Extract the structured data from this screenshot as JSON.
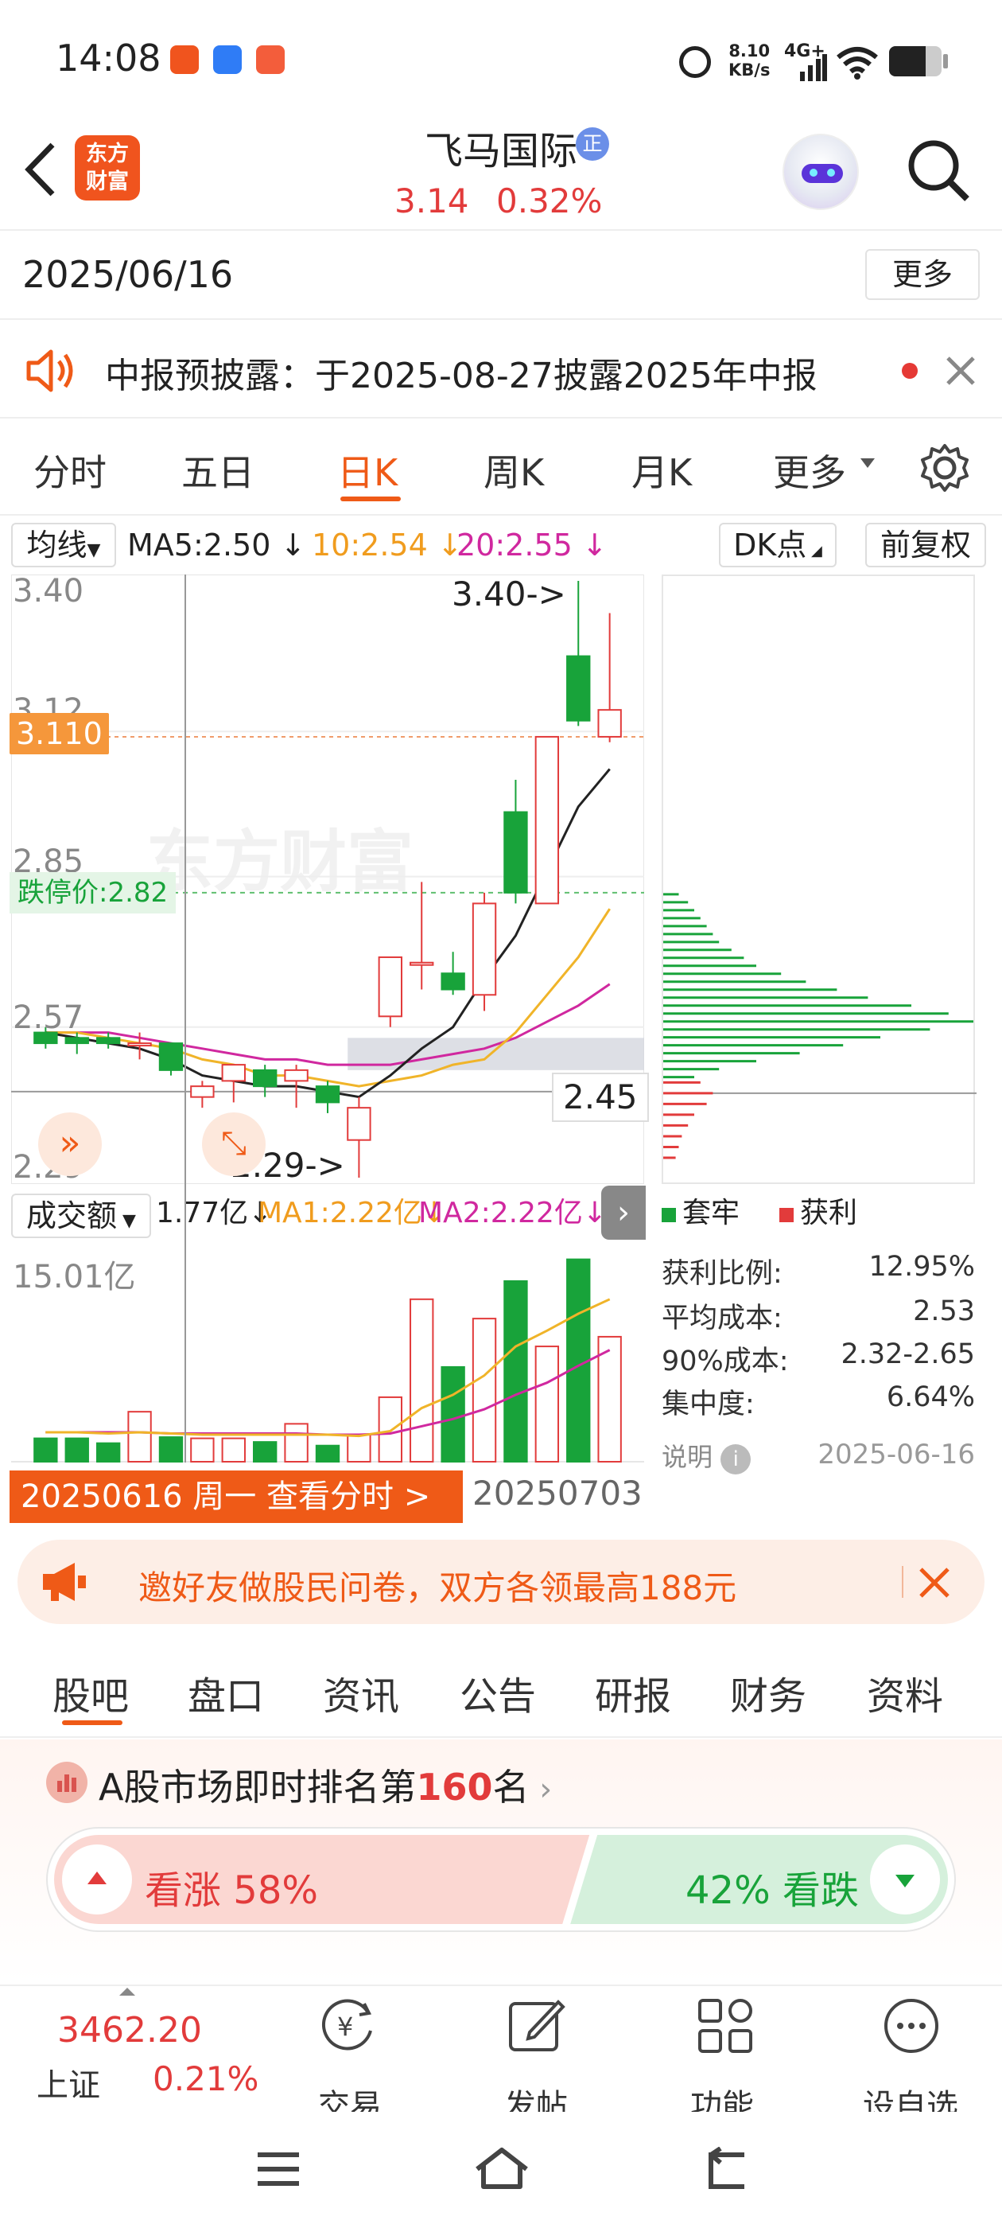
{
  "status_bar": {
    "time": "14:08",
    "speed_value": "8.10",
    "speed_unit": "KB/s",
    "network": "4G+"
  },
  "header": {
    "stock_name": "飞马国际",
    "badge": "正",
    "price": "3.14",
    "change_pct": "0.32%",
    "logo_line1": "东方",
    "logo_line2": "财富"
  },
  "date_row": {
    "date": "2025/06/16",
    "more_label": "更多"
  },
  "notice": {
    "text": "中报预披露：于2025-08-27披露2025年中报"
  },
  "chart_tabs": [
    {
      "label": "分时",
      "selected": false
    },
    {
      "label": "五日",
      "selected": false
    },
    {
      "label": "日K",
      "selected": true
    },
    {
      "label": "周K",
      "selected": false
    },
    {
      "label": "月K",
      "selected": false
    },
    {
      "label": "更多",
      "selected": false
    }
  ],
  "ma_row": {
    "selector": "均线",
    "ma5": "MA5:2.50",
    "ma10": "10:2.54",
    "ma20": "20:2.55",
    "dk_label": "DK点",
    "fq_label": "前复权"
  },
  "price_axis": {
    "p340": "3.40",
    "p312": "3.12",
    "p285": "2.85",
    "p257": "2.57",
    "p229": "2.29"
  },
  "price_tags": {
    "current": "3.110",
    "limit_down": "跌停价:2.82",
    "high_label": "3.40->",
    "low_label": "2.29->",
    "crosshair_value": "2.45"
  },
  "watermark": "东方财富",
  "volume_row": {
    "selector": "成交额",
    "value": "1.77亿",
    "ma1": "MA1:2.22亿",
    "ma2": "MA2:2.22亿",
    "axis_max": "15.01亿"
  },
  "colors": {
    "up": "#e23b3b",
    "down": "#18a33a",
    "ma5": "#222222",
    "ma10": "#f0b429",
    "ma20": "#d0289f",
    "brand": "#ef5a17"
  },
  "chart_data": {
    "type": "candlestick",
    "ylim": [
      2.29,
      3.4
    ],
    "candles": [
      {
        "o": 2.56,
        "c": 2.54,
        "h": 2.57,
        "l": 2.53
      },
      {
        "o": 2.55,
        "c": 2.54,
        "h": 2.56,
        "l": 2.52
      },
      {
        "o": 2.55,
        "c": 2.54,
        "h": 2.56,
        "l": 2.53
      },
      {
        "o": 2.54,
        "c": 2.54,
        "h": 2.56,
        "l": 2.51
      },
      {
        "o": 2.54,
        "c": 2.49,
        "h": 2.54,
        "l": 2.48
      },
      {
        "o": 2.44,
        "c": 2.46,
        "h": 2.47,
        "l": 2.42
      },
      {
        "o": 2.47,
        "c": 2.5,
        "h": 2.5,
        "l": 2.43
      },
      {
        "o": 2.49,
        "c": 2.46,
        "h": 2.5,
        "l": 2.44
      },
      {
        "o": 2.47,
        "c": 2.49,
        "h": 2.5,
        "l": 2.42
      },
      {
        "o": 2.46,
        "c": 2.43,
        "h": 2.47,
        "l": 2.41
      },
      {
        "o": 2.36,
        "c": 2.42,
        "h": 2.44,
        "l": 2.29
      },
      {
        "o": 2.59,
        "c": 2.7,
        "h": 2.7,
        "l": 2.57
      },
      {
        "o": 2.69,
        "c": 2.69,
        "h": 2.84,
        "l": 2.64
      },
      {
        "o": 2.67,
        "c": 2.64,
        "h": 2.71,
        "l": 2.63
      },
      {
        "o": 2.63,
        "c": 2.8,
        "h": 2.82,
        "l": 2.6
      },
      {
        "o": 2.97,
        "c": 2.82,
        "h": 3.03,
        "l": 2.8
      },
      {
        "o": 2.8,
        "c": 3.11,
        "h": 3.11,
        "l": 2.8
      },
      {
        "o": 3.26,
        "c": 3.14,
        "h": 3.4,
        "l": 3.13
      },
      {
        "o": 3.11,
        "c": 3.16,
        "h": 3.34,
        "l": 3.1
      }
    ],
    "ma5": [
      2.56,
      2.55,
      2.54,
      2.53,
      2.51,
      2.48,
      2.47,
      2.46,
      2.46,
      2.45,
      2.44,
      2.48,
      2.53,
      2.57,
      2.66,
      2.74,
      2.86,
      2.98,
      3.05
    ],
    "ma10": [
      2.56,
      2.56,
      2.55,
      2.54,
      2.53,
      2.51,
      2.5,
      2.48,
      2.48,
      2.47,
      2.46,
      2.47,
      2.48,
      2.5,
      2.51,
      2.56,
      2.63,
      2.7,
      2.79
    ],
    "ma20": [
      2.56,
      2.56,
      2.56,
      2.55,
      2.54,
      2.53,
      2.52,
      2.51,
      2.51,
      2.5,
      2.5,
      2.5,
      2.51,
      2.52,
      2.53,
      2.55,
      2.58,
      2.61,
      2.65
    ],
    "volume_max": 15.01,
    "volume": [
      2.0,
      2.0,
      1.6,
      4.2,
      2.1,
      2.0,
      2.0,
      1.7,
      3.2,
      1.4,
      2.3,
      5.4,
      13.5,
      7.9,
      11.9,
      15.0,
      9.6,
      16.8,
      10.4
    ],
    "volume_ma1": [
      2.5,
      2.5,
      2.4,
      2.5,
      2.4,
      2.3,
      2.3,
      2.3,
      2.3,
      2.3,
      2.2,
      2.6,
      4.5,
      5.6,
      7.2,
      9.6,
      10.9,
      12.3,
      13.5
    ],
    "volume_ma2": [
      2.5,
      2.5,
      2.5,
      2.5,
      2.4,
      2.4,
      2.4,
      2.4,
      2.4,
      2.3,
      2.3,
      2.4,
      3.0,
      3.6,
      4.4,
      5.6,
      6.6,
      8.0,
      9.3
    ]
  },
  "chip_distribution": {
    "levels_profit": [
      0.12,
      0.16,
      0.14,
      0.1,
      0.08,
      0.06,
      0.05,
      0.04
    ],
    "levels_trap": [
      0.05,
      0.08,
      0.1,
      0.12,
      0.14,
      0.16,
      0.18,
      0.22,
      0.26,
      0.3,
      0.38,
      0.46,
      0.56,
      0.66,
      0.8,
      0.92,
      1.0,
      0.86,
      0.7,
      0.58,
      0.44,
      0.3,
      0.18,
      0.1
    ],
    "legend_trap": "套牢",
    "legend_profit": "获利",
    "stats": [
      {
        "label": "获利比例:",
        "value": "12.95%"
      },
      {
        "label": "平均成本:",
        "value": "2.53"
      },
      {
        "label": "90%成本:",
        "value": "2.32-2.65"
      },
      {
        "label": "集中度:",
        "value": "6.64%"
      }
    ],
    "note_label": "说明",
    "note_date": "2025-06-16"
  },
  "date_bar": {
    "text": "20250616 周一 查看分时 >",
    "end_date": "20250703"
  },
  "invite": {
    "text": "邀好友做股民问卷，双方各领最高188元"
  },
  "content_tabs": [
    {
      "label": "股吧",
      "selected": true
    },
    {
      "label": "盘口",
      "selected": false
    },
    {
      "label": "资讯",
      "selected": false
    },
    {
      "label": "公告",
      "selected": false
    },
    {
      "label": "研报",
      "selected": false
    },
    {
      "label": "财务",
      "selected": false
    },
    {
      "label": "资料",
      "selected": false
    }
  ],
  "ranking": {
    "prefix": "A股市场即时排名第",
    "rank": "160",
    "suffix": "名"
  },
  "vote": {
    "bull_label": "看涨",
    "bull_pct": "58%",
    "bear_pct": "42%",
    "bear_label": "看跌",
    "bull_ratio": 0.58
  },
  "bottom_bar": {
    "index_value": "3462.20",
    "index_name": "上证",
    "index_change": "0.21%",
    "trade": "交易",
    "post": "发帖",
    "func": "功能",
    "watch": "设自选"
  }
}
